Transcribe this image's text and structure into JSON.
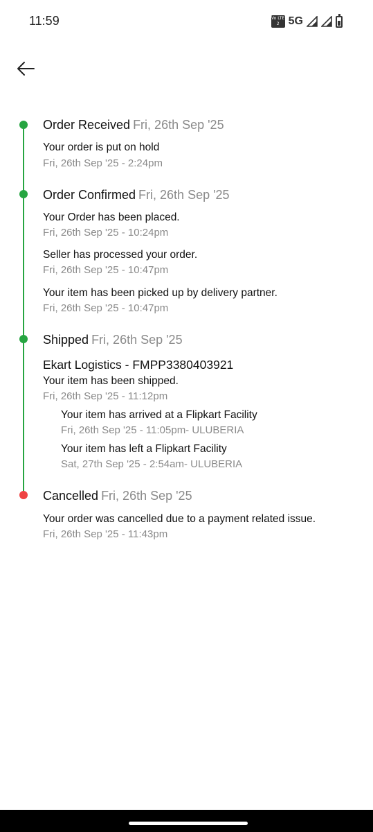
{
  "status_bar": {
    "time": "11:59",
    "volte": "Vo LTE 2",
    "network": "5G"
  },
  "colors": {
    "done": "#26a541",
    "cancelled": "#ef4343",
    "muted": "#8a8a8a"
  },
  "icons": {
    "back": "arrow-left-icon"
  },
  "timeline": {
    "received": {
      "title": "Order Received",
      "date": "Fri, 26th Sep '25",
      "events": [
        {
          "text": "Your order is put on hold",
          "time": "Fri, 26th Sep '25 - 2:24pm"
        }
      ]
    },
    "confirmed": {
      "title": "Order Confirmed",
      "date": "Fri, 26th Sep '25",
      "events": [
        {
          "text": "Your Order has been placed.",
          "time": "Fri, 26th Sep '25 - 10:24pm"
        },
        {
          "text": "Seller has processed your order.",
          "time": "Fri, 26th Sep '25 - 10:47pm"
        },
        {
          "text": "Your item has been picked up by delivery partner.",
          "time": "Fri, 26th Sep '25 - 10:47pm"
        }
      ]
    },
    "shipped": {
      "title": "Shipped",
      "date": "Fri, 26th Sep '25",
      "courier": "Ekart Logistics - FMPP3380403921",
      "events": [
        {
          "text": "Your item has been shipped.",
          "time": "Fri, 26th Sep '25 - 11:12pm"
        }
      ],
      "sub_events": [
        {
          "text": "Your item has arrived at a Flipkart Facility",
          "time": "Fri, 26th Sep '25 - 11:05pm- ULUBERIA"
        },
        {
          "text": "Your item has left a Flipkart Facility",
          "time": "Sat, 27th Sep '25 - 2:54am- ULUBERIA"
        }
      ]
    },
    "cancelled": {
      "title": "Cancelled",
      "date": "Fri, 26th Sep '25",
      "events": [
        {
          "text": "Your order was cancelled due to a payment related issue.",
          "time": "Fri, 26th Sep '25 - 11:43pm"
        }
      ]
    }
  }
}
